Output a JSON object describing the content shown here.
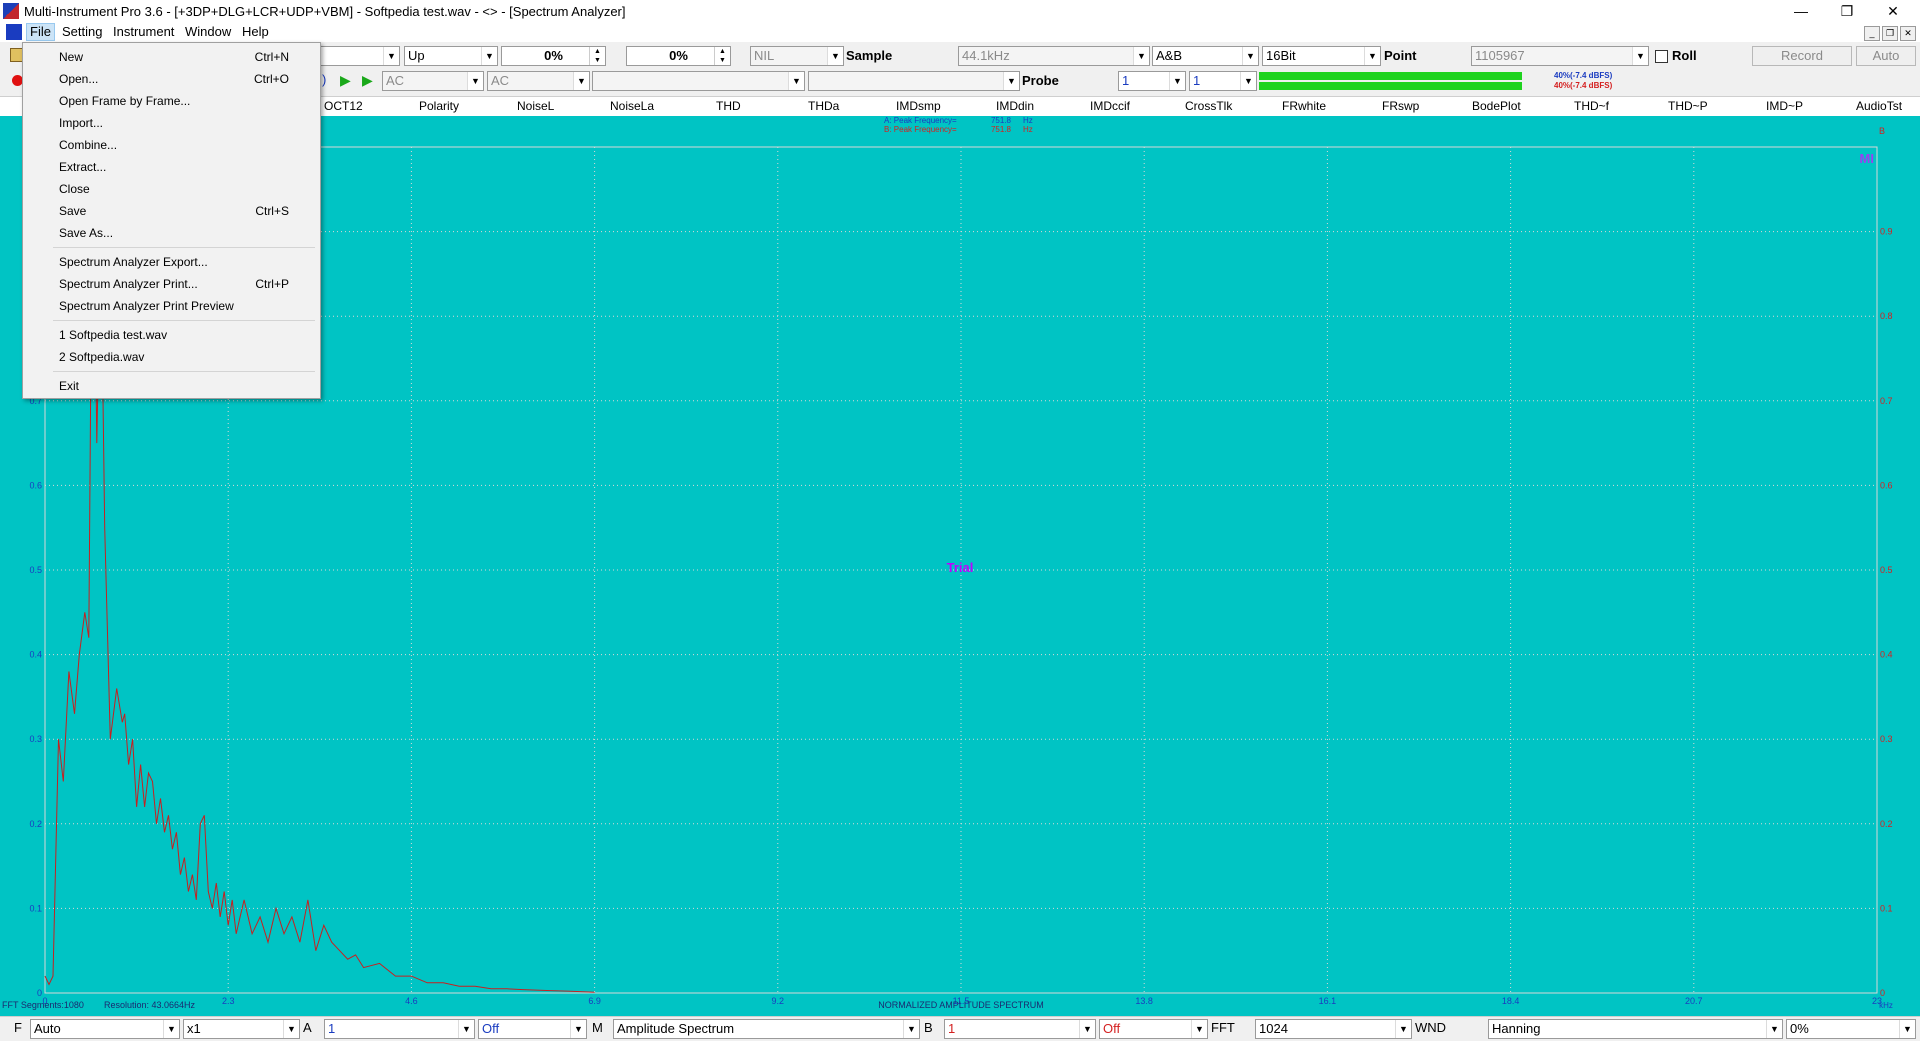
{
  "window": {
    "title": "Multi-Instrument Pro 3.6  -  [+3DP+DLG+LCR+UDP+VBM]   -   Softpedia test.wav   -   <> - [Spectrum Analyzer]",
    "minimize": "—",
    "restore": "❐",
    "close": "✕"
  },
  "menubar": {
    "items": [
      "File",
      "Setting",
      "Instrument",
      "Window",
      "Help"
    ],
    "mdi_minimize": "_",
    "mdi_restore": "❐",
    "mdi_close": "✕"
  },
  "file_menu": {
    "groups": [
      [
        {
          "label": "New",
          "shortcut": "Ctrl+N"
        },
        {
          "label": "Open...",
          "shortcut": "Ctrl+O"
        },
        {
          "label": "Open Frame by Frame...",
          "shortcut": ""
        },
        {
          "label": "Import...",
          "shortcut": ""
        },
        {
          "label": "Combine...",
          "shortcut": ""
        },
        {
          "label": "Extract...",
          "shortcut": ""
        },
        {
          "label": "Close",
          "shortcut": ""
        },
        {
          "label": "Save",
          "shortcut": "Ctrl+S"
        },
        {
          "label": "Save As...",
          "shortcut": ""
        }
      ],
      [
        {
          "label": "Spectrum Analyzer Export...",
          "shortcut": ""
        },
        {
          "label": "Spectrum Analyzer Print...",
          "shortcut": "Ctrl+P"
        },
        {
          "label": "Spectrum Analyzer Print Preview",
          "shortcut": ""
        }
      ],
      [
        {
          "label": "1 Softpedia test.wav",
          "shortcut": ""
        },
        {
          "label": "2 Softpedia.wav",
          "shortcut": ""
        }
      ],
      [
        {
          "label": "Exit",
          "shortcut": ""
        }
      ]
    ]
  },
  "toolbar1": {
    "trigger_mode": "",
    "trigger_edge": "Up",
    "trigger_level": "0%",
    "trigger_delay": "0%",
    "channel_mode": "NIL",
    "sample_label": "Sample",
    "sample_rate": "44.1kHz",
    "channels": "A&B",
    "bits": "16Bit",
    "point_label": "Point",
    "point_value": "1105967",
    "roll_label": "Roll",
    "record_label": "Record",
    "auto_label": "Auto"
  },
  "toolbar2": {
    "coupling_a": "AC",
    "coupling_b": "AC",
    "combo3": "",
    "combo4": "",
    "probe_label": "Probe",
    "probe_a": "1",
    "probe_b": "1",
    "meter_a": {
      "level": 0.4,
      "text": "40%(-7.4 dBFS)",
      "color": "#1a3cc0"
    },
    "meter_b": {
      "level": 0.4,
      "text": "40%(-7.4 dBFS)",
      "color": "#d42020"
    }
  },
  "tabs": [
    "OCT12",
    "Polarity",
    "NoiseL",
    "NoiseLa",
    "THD",
    "THDa",
    "IMDsmp",
    "IMDdin",
    "IMDccif",
    "CrossTlk",
    "FRwhite",
    "FRswp",
    "BodePlot",
    "THD~f",
    "THD~P",
    "IMD~P",
    "AudioTst"
  ],
  "plot": {
    "peak_a_label": "A: Peak Frequency=",
    "peak_a_value": "751.8",
    "peak_a_unit": "Hz",
    "peak_b_label": "B: Peak Frequency=",
    "peak_b_value": "751.8",
    "peak_b_unit": "Hz",
    "watermark": "Trial",
    "corner_logo": "MI",
    "right_axis_name": "B",
    "x_unit": "kHz",
    "x_title": "NORMALIZED AMPLITUDE SPECTRUM",
    "info_segments": "FFT Segments:1080",
    "info_resolution": "Resolution: 43.0664Hz",
    "colors": {
      "background": "#00c4c4",
      "trace": "#c62020",
      "grid": "#d8d8d8",
      "axis_text": "#1a3cc0",
      "watermark": "#c000ff"
    }
  },
  "chart_data": {
    "type": "line",
    "title": "NORMALIZED AMPLITUDE SPECTRUM",
    "xlabel": "kHz",
    "ylabel": "",
    "xlim": [
      0,
      23
    ],
    "ylim": [
      0,
      1
    ],
    "x_ticks": [
      "0",
      "2.3",
      "4.6",
      "6.9",
      "9.2",
      "11.5",
      "13.8",
      "16.1",
      "18.4",
      "20.7",
      "23"
    ],
    "y_ticks": [
      "0",
      "0.1",
      "0.2",
      "0.3",
      "0.4",
      "0.5",
      "0.6",
      "0.7",
      "0.8",
      "0.9",
      "1"
    ],
    "grid": true,
    "series": [
      {
        "name": "B",
        "color": "#c62020",
        "x": [
          0.0,
          0.05,
          0.1,
          0.17,
          0.23,
          0.3,
          0.37,
          0.43,
          0.5,
          0.55,
          0.6,
          0.65,
          0.7,
          0.75,
          0.82,
          0.9,
          0.97,
          1.0,
          1.05,
          1.1,
          1.15,
          1.2,
          1.25,
          1.3,
          1.35,
          1.4,
          1.45,
          1.5,
          1.55,
          1.6,
          1.65,
          1.7,
          1.75,
          1.8,
          1.85,
          1.9,
          1.95,
          2.0,
          2.05,
          2.1,
          2.15,
          2.2,
          2.25,
          2.3,
          2.35,
          2.4,
          2.45,
          2.5,
          2.6,
          2.7,
          2.8,
          2.9,
          3.0,
          3.1,
          3.2,
          3.3,
          3.4,
          3.5,
          3.6,
          3.7,
          3.8,
          3.9,
          4.0,
          4.2,
          4.4,
          4.6,
          4.8,
          5.0,
          5.2,
          5.4,
          5.6,
          5.8,
          6.0,
          6.3,
          6.6,
          6.9
        ],
        "values": [
          0.02,
          0.01,
          0.02,
          0.3,
          0.25,
          0.38,
          0.33,
          0.4,
          0.45,
          0.42,
          1.08,
          0.65,
          0.9,
          0.55,
          0.3,
          0.36,
          0.32,
          0.33,
          0.27,
          0.3,
          0.22,
          0.27,
          0.22,
          0.26,
          0.25,
          0.2,
          0.23,
          0.19,
          0.21,
          0.17,
          0.19,
          0.14,
          0.16,
          0.12,
          0.14,
          0.11,
          0.2,
          0.21,
          0.12,
          0.1,
          0.13,
          0.09,
          0.12,
          0.08,
          0.11,
          0.07,
          0.09,
          0.11,
          0.07,
          0.09,
          0.06,
          0.1,
          0.07,
          0.09,
          0.06,
          0.11,
          0.05,
          0.08,
          0.06,
          0.05,
          0.04,
          0.045,
          0.03,
          0.035,
          0.02,
          0.02,
          0.012,
          0.012,
          0.008,
          0.008,
          0.005,
          0.005,
          0.004,
          0.003,
          0.002,
          0.001
        ]
      }
    ]
  },
  "bottombar": {
    "f_label": "F",
    "f_value": "Auto",
    "zoom": "x1",
    "a_label": "A",
    "a_value": "1",
    "a_mode": "Off",
    "m_label": "M",
    "m_value": "Amplitude Spectrum",
    "b_label": "B",
    "b_value": "1",
    "b_mode": "Off",
    "fft_label": "FFT",
    "fft_value": "1024",
    "wnd_label": "WND",
    "wnd_value": "Hanning",
    "overlap": "0%"
  }
}
